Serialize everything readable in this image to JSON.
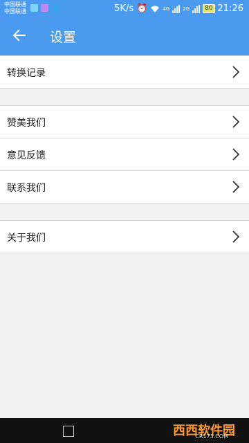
{
  "status_bar": {
    "carrier_1": "中国联通",
    "carrier_2": "中国联通",
    "speed": "5K/s",
    "network_1": "4G",
    "network_2": "2G",
    "battery": "80",
    "time": "21:26"
  },
  "app_bar": {
    "title": "设置"
  },
  "settings": {
    "group1": [
      {
        "label": "转换记录"
      }
    ],
    "group2": [
      {
        "label": "赞美我们"
      },
      {
        "label": "意见反馈"
      },
      {
        "label": "联系我们"
      }
    ],
    "group3": [
      {
        "label": "关于我们"
      }
    ]
  },
  "watermark": {
    "text": "西西软件园",
    "sub": "CR173.COM"
  },
  "colors": {
    "primary": "#4a9bef",
    "background": "#f2f2f2"
  }
}
